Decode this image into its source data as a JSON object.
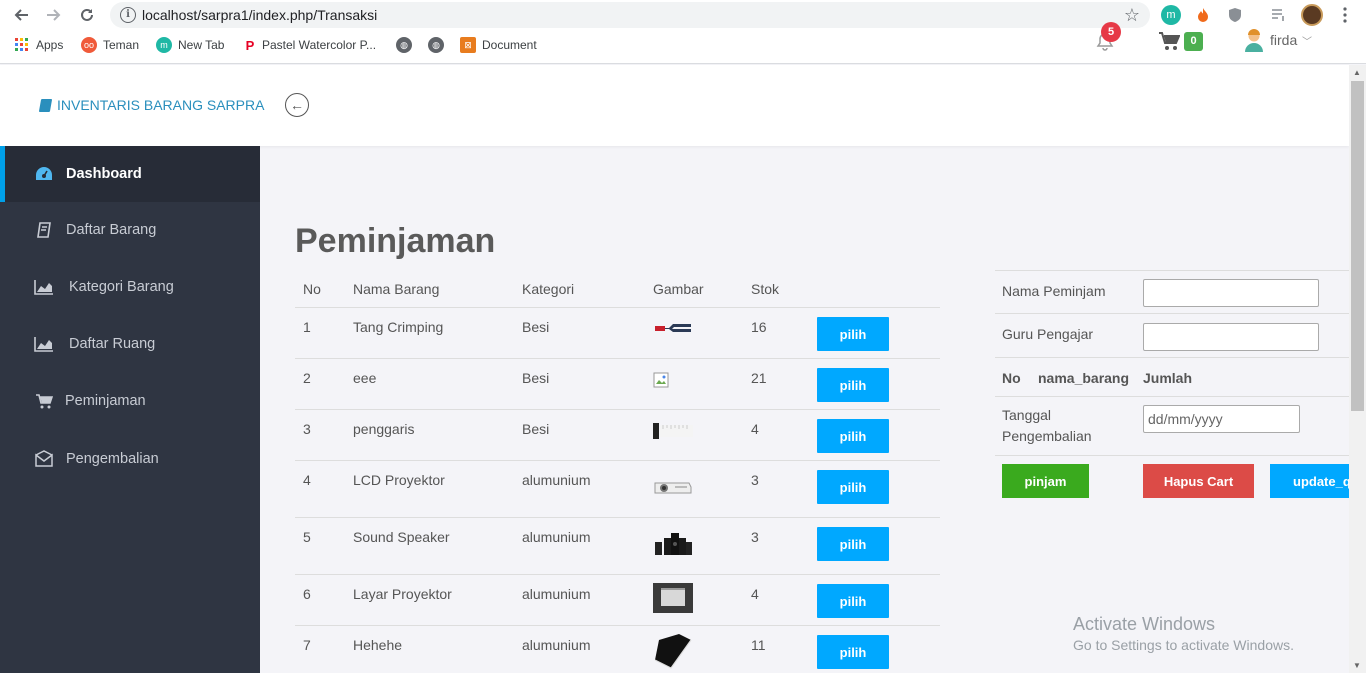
{
  "browser": {
    "url": "localhost/sarpra1/index.php/Transaksi",
    "bookmarks": [
      {
        "label": "Apps",
        "icon": "apps-grid-icon"
      },
      {
        "label": "Teman",
        "icon": "teman-icon"
      },
      {
        "label": "New Tab",
        "icon": "new-tab-icon"
      },
      {
        "label": "Pastel Watercolor P...",
        "icon": "pinterest-icon"
      },
      {
        "label": "",
        "icon": "globe-icon"
      },
      {
        "label": "",
        "icon": "globe-icon"
      },
      {
        "label": "Document",
        "icon": "document-icon"
      }
    ]
  },
  "header": {
    "brand": "INVENTARIS BARANG SARPRA",
    "notifications": "5",
    "cart_count": "0",
    "user": "firda"
  },
  "sidebar": {
    "items": [
      {
        "label": "Dashboard",
        "icon": "dashboard-icon",
        "active": true
      },
      {
        "label": "Daftar Barang",
        "icon": "book-icon"
      },
      {
        "label": "Kategori Barang",
        "icon": "area-chart-icon"
      },
      {
        "label": "Daftar Ruang",
        "icon": "area-chart-icon"
      },
      {
        "label": "Peminjaman",
        "icon": "cart-icon"
      },
      {
        "label": "Pengembalian",
        "icon": "envelope-icon"
      }
    ]
  },
  "main": {
    "title": "Peminjaman",
    "columns": [
      "No",
      "Nama Barang",
      "Kategori",
      "Gambar",
      "Stok"
    ],
    "rows": [
      {
        "no": "1",
        "nama": "Tang Crimping",
        "kategori": "Besi",
        "stok": "16",
        "gambar": "crimping-tool"
      },
      {
        "no": "2",
        "nama": "eee",
        "kategori": "Besi",
        "stok": "21",
        "gambar": "broken-image"
      },
      {
        "no": "3",
        "nama": "penggaris",
        "kategori": "Besi",
        "stok": "4",
        "gambar": "ruler"
      },
      {
        "no": "4",
        "nama": "LCD Proyektor",
        "kategori": "alumunium",
        "stok": "3",
        "gambar": "projector"
      },
      {
        "no": "5",
        "nama": "Sound Speaker",
        "kategori": "alumunium",
        "stok": "3",
        "gambar": "speaker"
      },
      {
        "no": "6",
        "nama": "Layar Proyektor",
        "kategori": "alumunium",
        "stok": "4",
        "gambar": "screen"
      },
      {
        "no": "7",
        "nama": "Hehehe",
        "kategori": "alumunium",
        "stok": "11",
        "gambar": "book"
      }
    ],
    "pilih_label": "pilih"
  },
  "form": {
    "nama_peminjam_label": "Nama Peminjam",
    "guru_pengajar_label": "Guru Pengajar",
    "cart_columns": [
      "No",
      "nama_barang",
      "Jumlah"
    ],
    "tanggal_label_1": "Tanggal",
    "tanggal_label_2": "Pengembalian",
    "date_placeholder": "dd/mm/yyyy",
    "pinjam_label": "pinjam",
    "hapus_label": "Hapus Cart",
    "update_label": "update_q"
  },
  "watermark": {
    "line1": "Activate Windows",
    "line2": "Go to Settings to activate Windows."
  },
  "colors": {
    "sidebar_bg": "#2f3542",
    "accent_blue": "#00a8ff",
    "brand_blue": "#2a8fbd",
    "pinjam_green": "#3aaa1e",
    "hapus_red": "#dc4b47"
  }
}
